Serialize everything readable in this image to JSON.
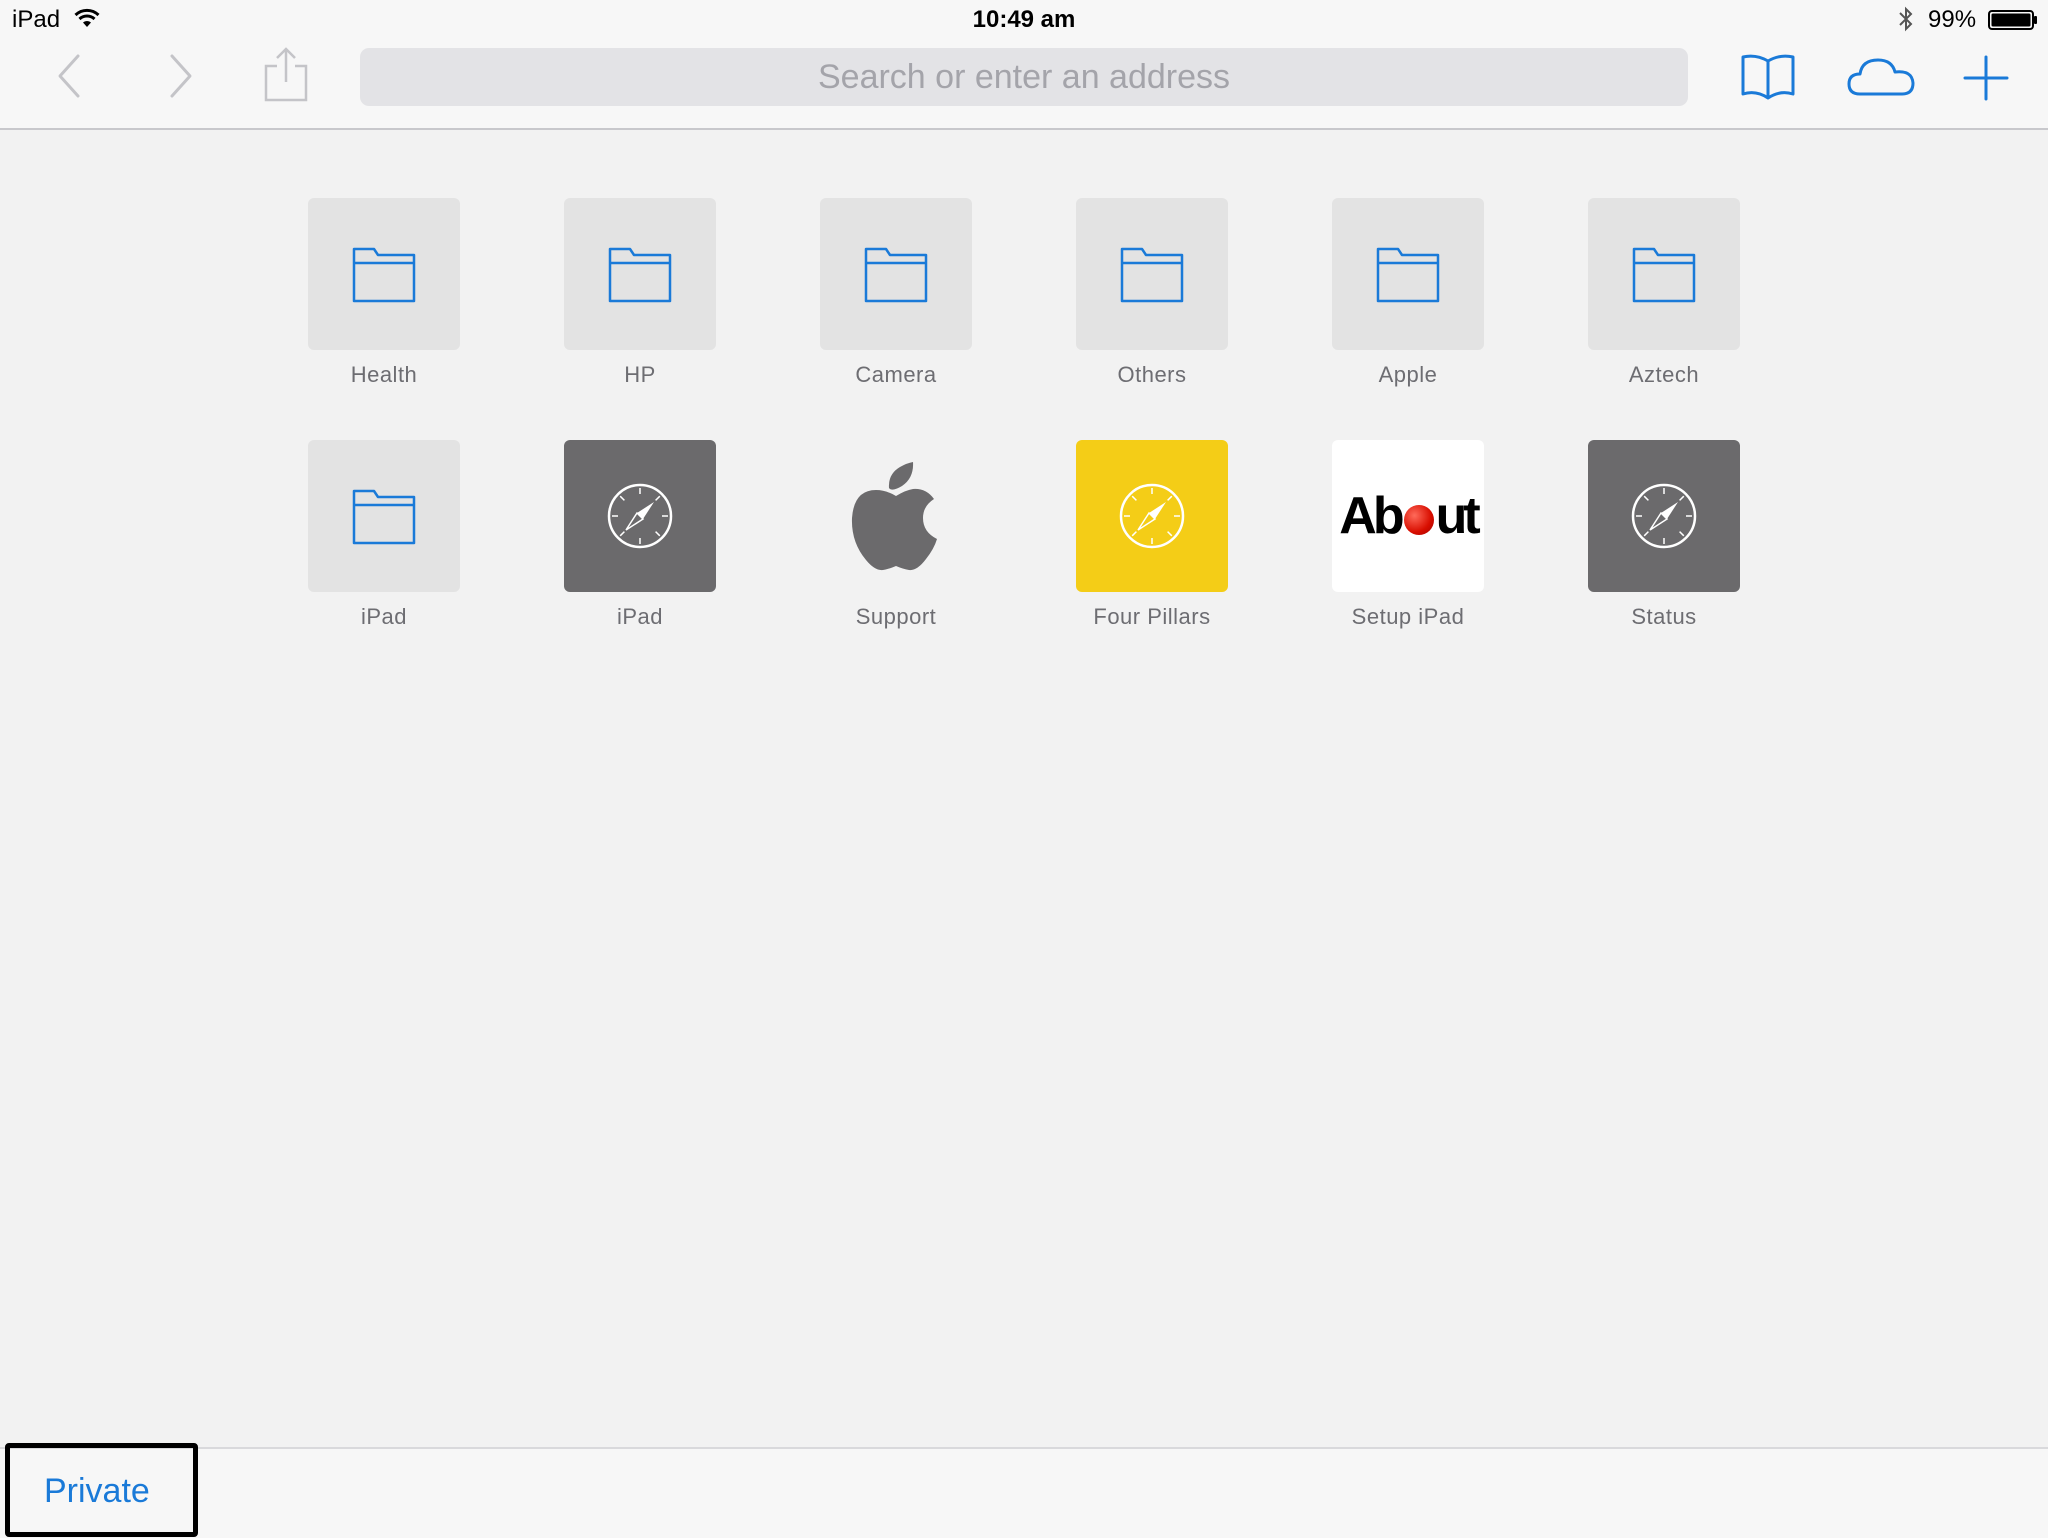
{
  "status_bar": {
    "device": "iPad",
    "time": "10:49 am",
    "battery_percent": "99%"
  },
  "toolbar": {
    "back_icon": "chevron-left",
    "forward_icon": "chevron-right",
    "share_icon": "share",
    "bookmarks_icon": "open-book",
    "icloud_tabs_icon": "cloud",
    "new_tab_icon": "plus",
    "accent_color": "#1a7ad8"
  },
  "search": {
    "placeholder": "Search or enter an address",
    "value": ""
  },
  "favorites": [
    {
      "label": "Health",
      "icon": "folder"
    },
    {
      "label": "HP",
      "icon": "folder"
    },
    {
      "label": "Camera",
      "icon": "folder"
    },
    {
      "label": "Others",
      "icon": "folder"
    },
    {
      "label": "Apple",
      "icon": "folder"
    },
    {
      "label": "Aztech",
      "icon": "folder"
    },
    {
      "label": "iPad",
      "icon": "folder"
    },
    {
      "label": "iPad",
      "icon": "compass-dark"
    },
    {
      "label": "Support",
      "icon": "apple-logo"
    },
    {
      "label": "Four Pillars",
      "icon": "compass-yellow"
    },
    {
      "label": "Setup iPad",
      "icon": "about-logo",
      "logo_text": "About"
    },
    {
      "label": "Status",
      "icon": "compass-dark"
    }
  ],
  "bottom_bar": {
    "private_label": "Private"
  }
}
